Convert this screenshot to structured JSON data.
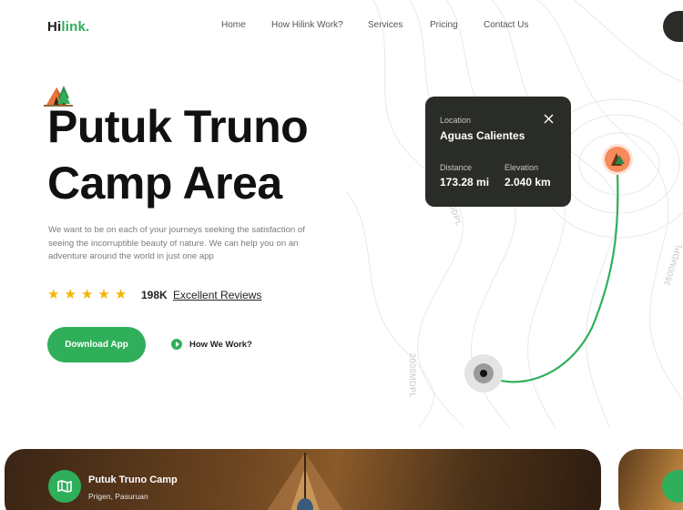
{
  "brand": {
    "prefix": "Hi",
    "suffix": "link."
  },
  "nav": {
    "items": [
      "Home",
      "How Hilink Work?",
      "Services",
      "Pricing",
      "Contact Us"
    ]
  },
  "hero": {
    "title_line1": "Putuk Truno",
    "title_line2": "Camp Area",
    "description": "We want to be on each of your journeys seeking the satisfaction of seeing the incorruptible beauty of nature. We can help you on an adventure around the world in just one app",
    "rating": 5,
    "review_count": "198K",
    "review_label": "Excellent Reviews",
    "cta_primary": "Download App",
    "cta_secondary": "How We Work?"
  },
  "map": {
    "contour_labels": [
      "2000MDPL",
      "3600MDPL",
      "00DPL"
    ]
  },
  "location_card": {
    "location_label": "Location",
    "location_value": "Aguas Calientes",
    "distance_label": "Distance",
    "distance_value": "173.28 mi",
    "elevation_label": "Elevation",
    "elevation_value": "2.040 km"
  },
  "gallery": {
    "items": [
      {
        "name": "Putuk Truno Camp",
        "location": "Prigen, Pasuruan"
      }
    ]
  },
  "colors": {
    "accent": "#30af5b",
    "dark": "#292c27",
    "marker": "#f7895a",
    "star": "#f5b400"
  },
  "icons": [
    "camp-icon",
    "star-icon",
    "play-icon",
    "close-icon",
    "camp-marker-icon",
    "start-marker-icon",
    "map-icon"
  ]
}
